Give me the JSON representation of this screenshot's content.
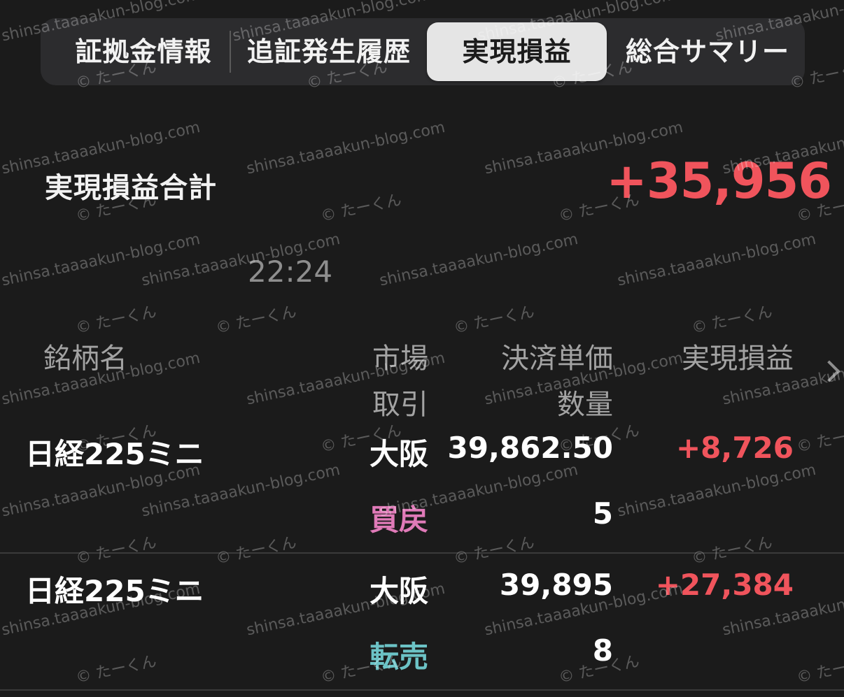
{
  "tabs": [
    {
      "label": "証拠金情報",
      "active": false
    },
    {
      "label": "追証発生履歴",
      "active": false
    },
    {
      "label": "実現損益",
      "active": true
    },
    {
      "label": "総合サマリー",
      "active": false
    }
  ],
  "summary": {
    "label": "実現損益合計",
    "value": "+35,956"
  },
  "time": "22:24",
  "columns": {
    "name": "銘柄名",
    "market": "市場",
    "trade": "取引",
    "price": "決済単価",
    "qty": "数量",
    "pnl": "実現損益"
  },
  "rows": [
    {
      "name": "日経225ミニ",
      "market": "大阪",
      "trade": "買戻",
      "price": "39,862.50",
      "qty": "5",
      "pnl": "+8,726"
    },
    {
      "name": "日経225ミニ",
      "market": "大阪",
      "trade": "転売",
      "price": "39,895",
      "qty": "8",
      "pnl": "+27,384"
    }
  ],
  "watermark": {
    "site": "shinsa.taaaakun-blog.com",
    "author": "© たーくん"
  },
  "colors": {
    "background": "#1b1b1b",
    "profit": "#f0545c",
    "buyback": "#e07ab8",
    "resell": "#6cc3c6",
    "header_text": "#a3a3a3"
  },
  "icons": {
    "scroll_right": "chevron-right-icon"
  }
}
